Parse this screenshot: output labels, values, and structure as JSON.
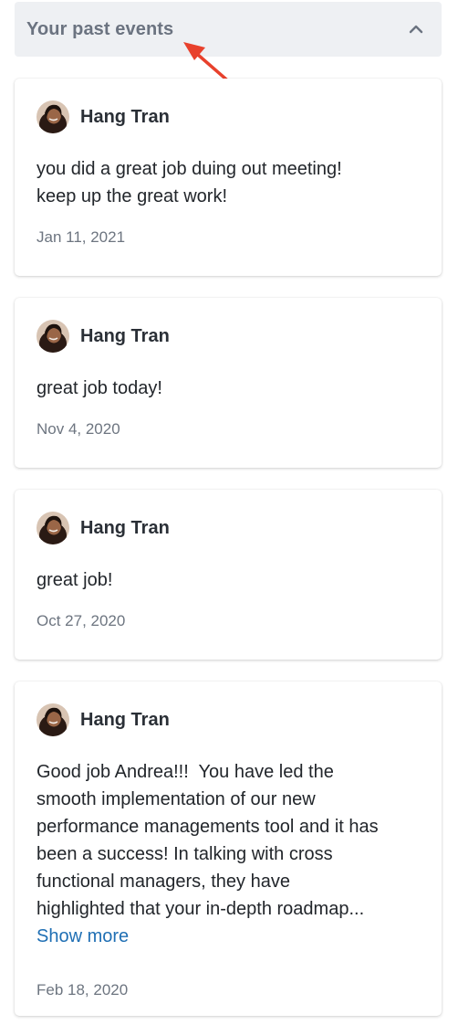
{
  "section": {
    "title": "Your past events"
  },
  "icons": {
    "toggle": "chevron-up-icon",
    "annotation": "red-arrow-annotation",
    "avatar": "avatar-image"
  },
  "colors": {
    "header_bg": "#eef0f3",
    "header_text": "#6b7380",
    "link": "#1f6fb4",
    "arrow": "#e8412c",
    "date": "#6d7580"
  },
  "events": [
    {
      "author": "Hang Tran",
      "message": "you did a great job duing out meeting!\nkeep up the great work!",
      "date": "Jan 11, 2021"
    },
    {
      "author": "Hang Tran",
      "message": "great job today!",
      "date": "Nov 4, 2020"
    },
    {
      "author": "Hang Tran",
      "message": "great job!",
      "date": "Oct 27, 2020"
    },
    {
      "author": "Hang Tran",
      "message": "Good job Andrea!!!  You have led the\nsmooth implementation of our new\nperformance managements tool and it has\nbeen a success! In talking with cross\nfunctional managers, they have\nhighlighted that your in-depth roadmap...",
      "show_more": "Show more",
      "date": "Feb 18, 2020"
    }
  ]
}
